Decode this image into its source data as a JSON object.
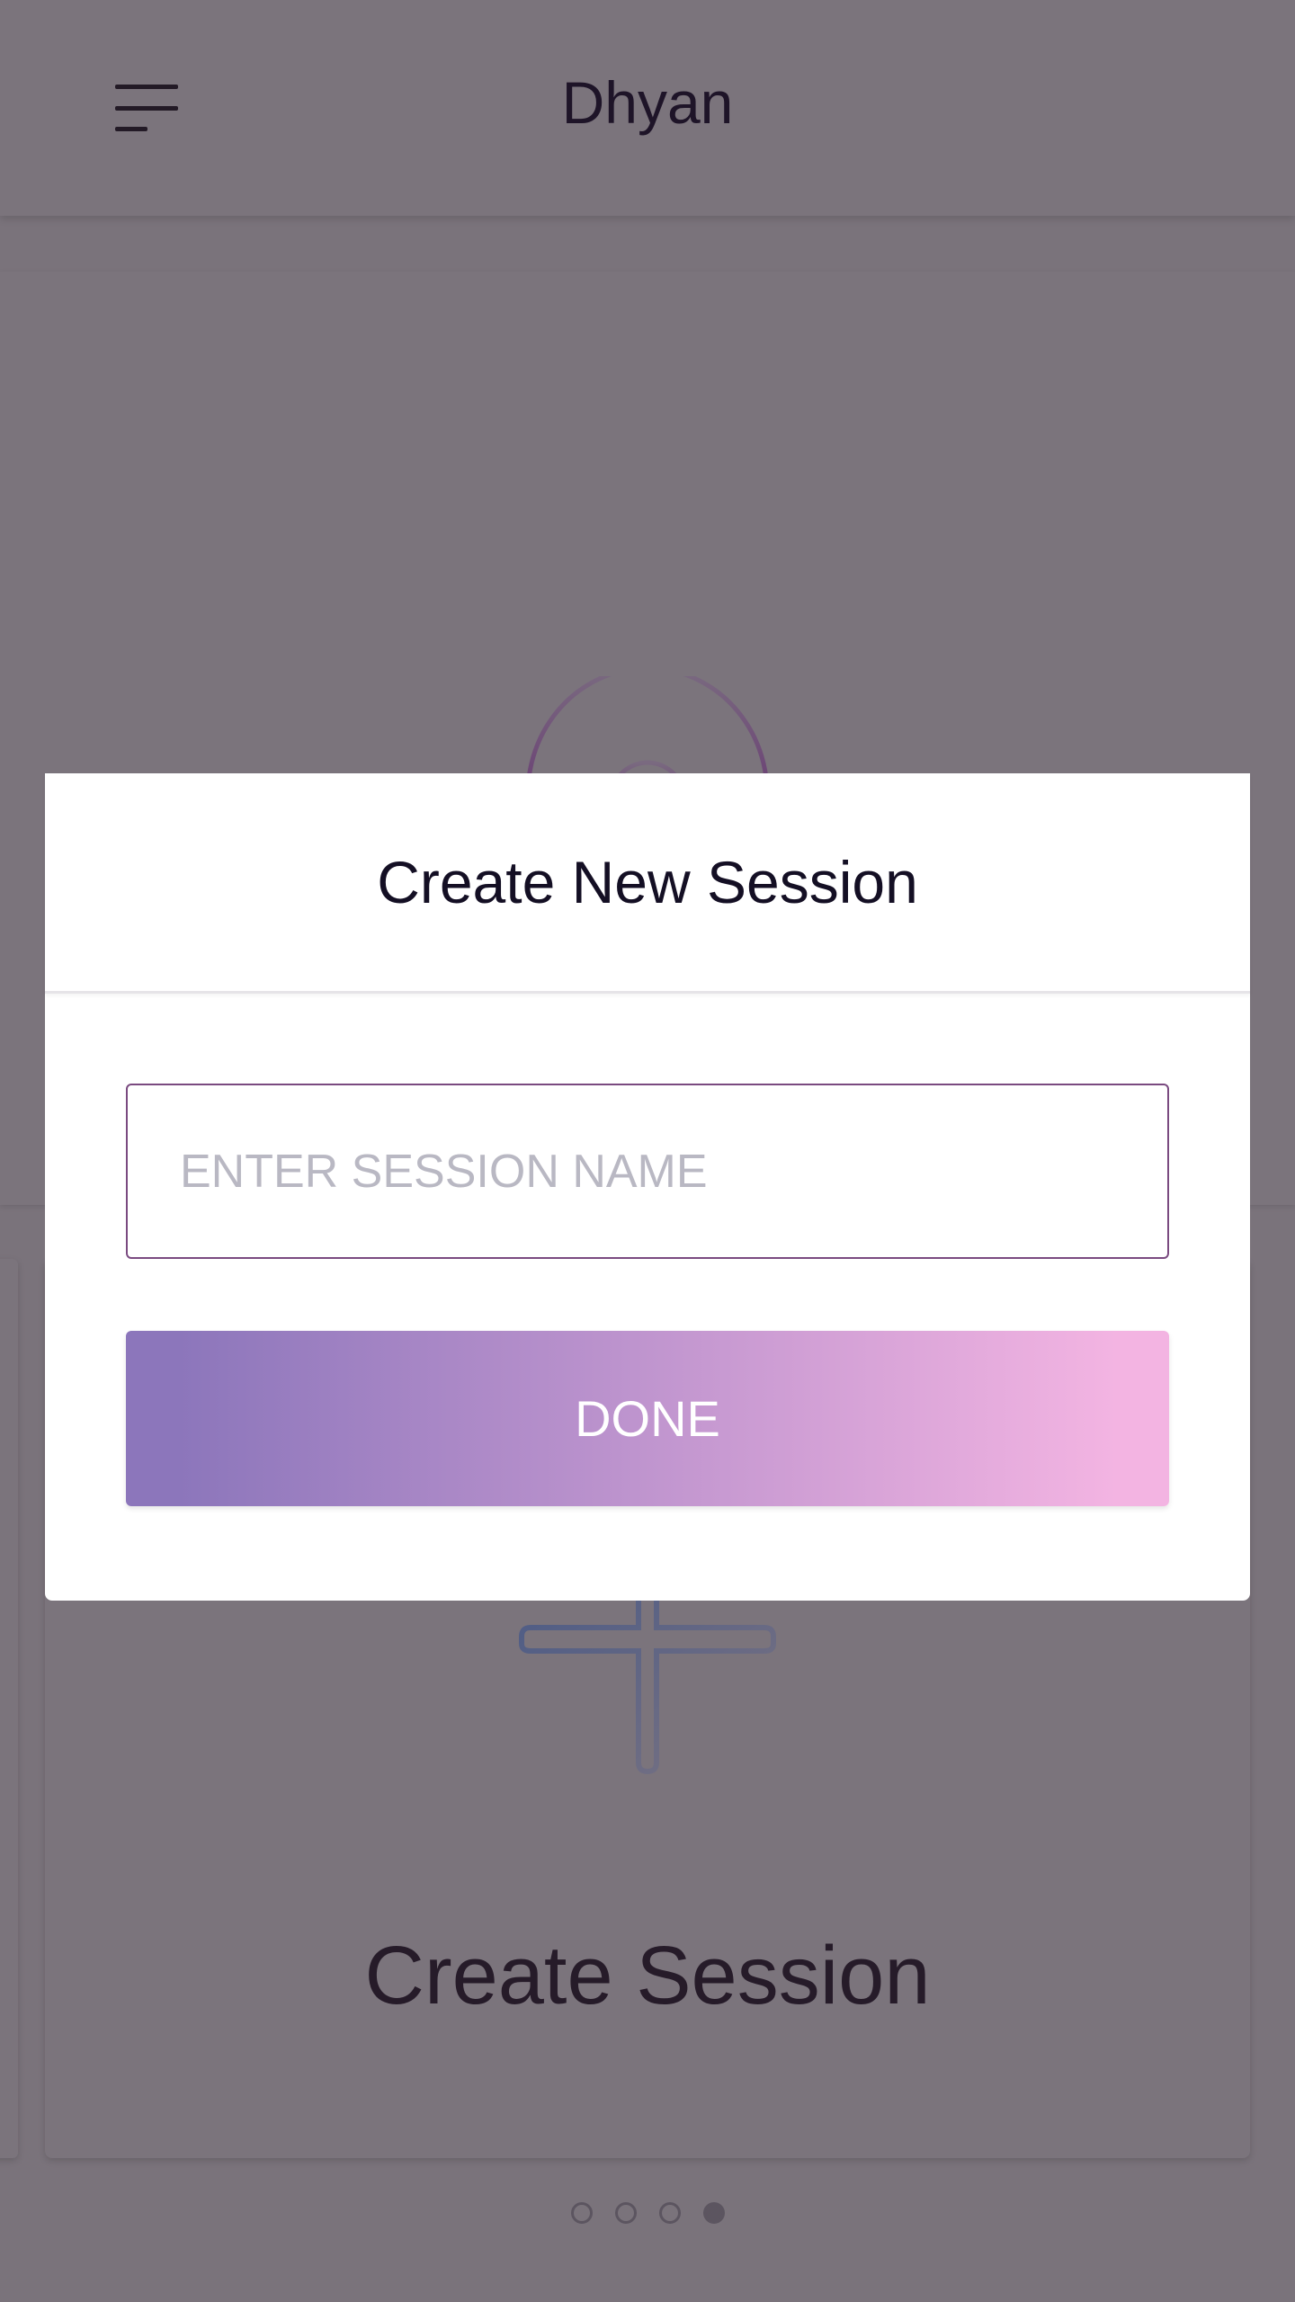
{
  "header": {
    "title": "Dhyan",
    "menu_icon": "hamburger-menu-icon"
  },
  "carousel": {
    "top_card_icon": "meditation-logo-icon",
    "card": {
      "icon": "plus-icon",
      "label": "Create Session"
    },
    "page_count": 4,
    "active_page": 4
  },
  "modal": {
    "title": "Create New Session",
    "input": {
      "value": "",
      "placeholder": "ENTER SESSION NAME"
    },
    "done_label": "DONE"
  },
  "colors": {
    "accent_start": "#8c76bb",
    "accent_end": "#f3b4e2",
    "input_border": "#7a4a80",
    "overlay": "#7a737b"
  }
}
